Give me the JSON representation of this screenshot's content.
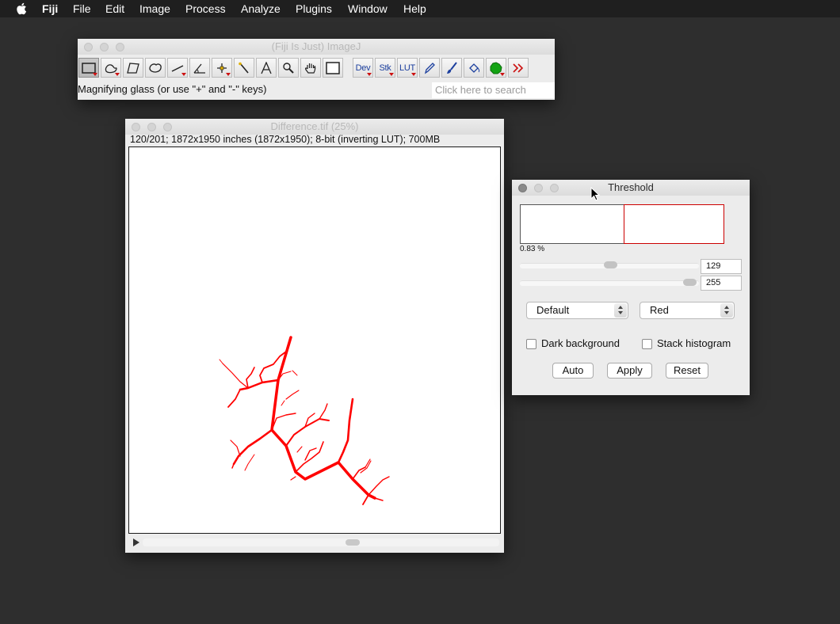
{
  "menubar": {
    "app_name": "Fiji",
    "items": [
      "File",
      "Edit",
      "Image",
      "Process",
      "Analyze",
      "Plugins",
      "Window",
      "Help"
    ]
  },
  "imagej_window": {
    "title": "(Fiji Is Just) ImageJ",
    "tools": [
      {
        "name": "rectangle-tool-icon",
        "selected": true,
        "has_menu": true
      },
      {
        "name": "freehand-tool-icon",
        "has_menu": true
      },
      {
        "name": "polygon-tool-icon"
      },
      {
        "name": "oval-tool-icon"
      },
      {
        "name": "line-tool-icon",
        "has_menu": true
      },
      {
        "name": "angle-tool-icon"
      },
      {
        "name": "point-tool-icon",
        "has_menu": true
      },
      {
        "name": "wand-tool-icon"
      },
      {
        "name": "text-tool-icon"
      },
      {
        "name": "magnifier-tool-icon"
      },
      {
        "name": "hand-tool-icon"
      },
      {
        "name": "color-picker-tool-icon"
      },
      {
        "name": "dev-menu",
        "label": "Dev",
        "has_menu": true
      },
      {
        "name": "stacks-menu",
        "label": "Stk",
        "has_menu": true
      },
      {
        "name": "lut-menu",
        "label": "LUT",
        "has_menu": true
      },
      {
        "name": "pencil-tool-icon"
      },
      {
        "name": "paintbrush-tool-icon"
      },
      {
        "name": "flood-fill-tool-icon"
      },
      {
        "name": "green-blob-tool-icon",
        "has_menu": true
      },
      {
        "name": "more-tools-icon"
      }
    ],
    "status": "Magnifying glass (or use \"+\" and \"-\" keys)",
    "search_placeholder": "Click here to search"
  },
  "image_window": {
    "title": "Difference.tif (25%)",
    "info": "120/201; 1872x1950 inches (1872x1950); 8-bit (inverting LUT); 700MB",
    "overlay_color": "#ff0000"
  },
  "threshold_window": {
    "title": "Threshold",
    "percentage": "0.83 %",
    "min_value": "129",
    "max_value": "255",
    "min_fraction": 0.506,
    "max_fraction": 1.0,
    "method": "Default",
    "display": "Red",
    "dark_background_label": "Dark background",
    "dark_background_checked": false,
    "stack_histogram_label": "Stack histogram",
    "stack_histogram_checked": false,
    "buttons": {
      "auto": "Auto",
      "apply": "Apply",
      "reset": "Reset"
    }
  }
}
